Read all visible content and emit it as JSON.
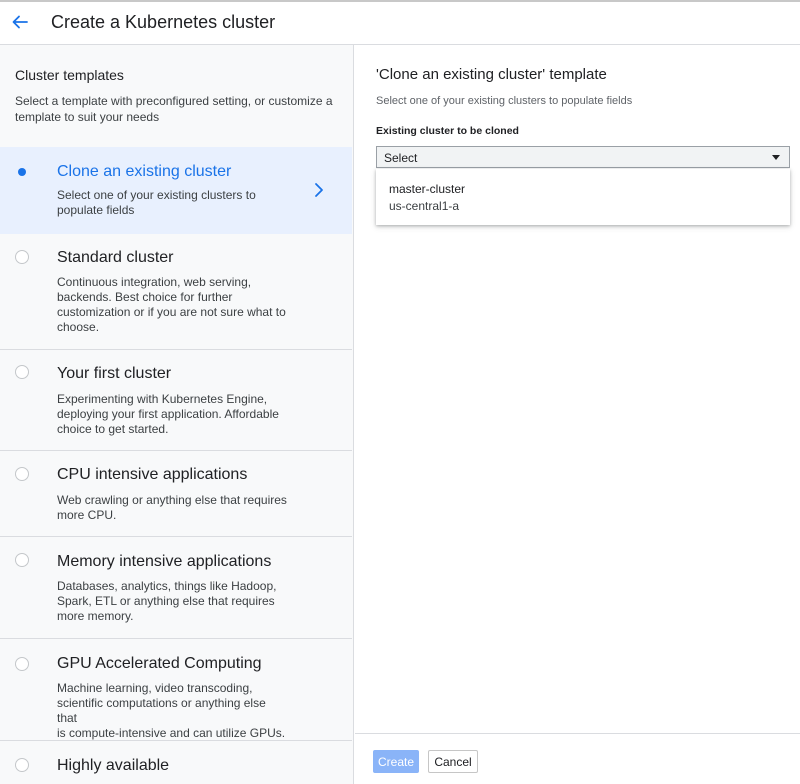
{
  "header": {
    "title": "Create a Kubernetes cluster",
    "back_icon": "arrow-back-icon",
    "accent_color": "#1a73e8"
  },
  "sidebar": {
    "title": "Cluster templates",
    "description": "Select a template with preconfigured setting, or customize a template to suit your needs",
    "templates": [
      {
        "title": "Clone an existing cluster",
        "desc_lines": [
          "Select one of your existing clusters to",
          "populate fields"
        ],
        "selected": true
      },
      {
        "title": "Standard cluster",
        "desc_lines": [
          "Continuous integration, web serving,",
          "backends. Best choice for further",
          "customization or if you are not sure what to",
          "choose."
        ],
        "selected": false
      },
      {
        "title": "Your first cluster",
        "desc_lines": [
          "Experimenting with Kubernetes Engine,",
          "deploying your first application. Affordable",
          "choice to get started."
        ],
        "selected": false
      },
      {
        "title": "CPU intensive applications",
        "desc_lines": [
          "Web crawling or anything else that requires",
          "more CPU."
        ],
        "selected": false
      },
      {
        "title": "Memory intensive applications",
        "desc_lines": [
          "Databases, analytics, things like Hadoop,",
          "Spark, ETL or anything else that requires",
          "more memory."
        ],
        "selected": false
      },
      {
        "title": "GPU Accelerated Computing",
        "desc_lines": [
          "Machine learning, video transcoding,",
          "scientific computations or anything else that",
          "is compute-intensive and can utilize GPUs."
        ],
        "selected": false
      },
      {
        "title": "Highly available",
        "desc_lines": [],
        "selected": false
      }
    ]
  },
  "main": {
    "title": "'Clone an existing cluster' template",
    "subtitle": "Select one of your existing clusters to populate fields",
    "field_label": "Existing cluster to be cloned",
    "select_value": "Select",
    "options": [
      {
        "name": "master-cluster",
        "zone": "us-central1-a"
      }
    ]
  },
  "footer": {
    "create_label": "Create",
    "cancel_label": "Cancel"
  }
}
